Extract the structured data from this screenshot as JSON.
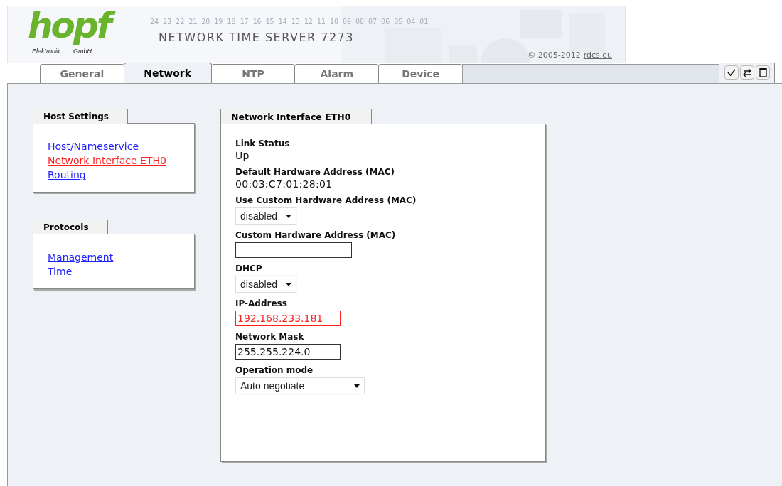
{
  "header": {
    "logo": "hopf",
    "logo_left": "Elektronik",
    "logo_right": "GmbH",
    "title": "NETWORK TIME SERVER 7273",
    "scale": "24 23 22 21 20 19 18 17 16 15 14 13 12 11 10 09 08 07 06 05 04 01",
    "copyright": "© 2005-2012",
    "copyright_link": "rdcs.eu"
  },
  "tabs": [
    {
      "label": "General",
      "selected": false
    },
    {
      "label": "Network",
      "selected": true
    },
    {
      "label": "NTP",
      "selected": false
    },
    {
      "label": "Alarm",
      "selected": false
    },
    {
      "label": "Device",
      "selected": false
    }
  ],
  "toolbar": [
    {
      "kind": "check"
    },
    {
      "kind": "swap"
    },
    {
      "kind": "page"
    }
  ],
  "panels": [
    {
      "title": "Host Settings",
      "links": [
        {
          "label": "Host/Nameservice",
          "selected": false
        },
        {
          "label": "Network Interface ETH0",
          "selected": true
        },
        {
          "label": "Routing",
          "selected": false
        }
      ]
    },
    {
      "title": "Protocols",
      "links": [
        {
          "label": "Management",
          "selected": false
        },
        {
          "label": "Time",
          "selected": false
        }
      ]
    }
  ],
  "interface": {
    "title": "Network Interface ETH0",
    "fields": [
      {
        "kind": "info",
        "label": "Link Status",
        "value": "Up"
      },
      {
        "kind": "info",
        "label": "Default Hardware Address (MAC)",
        "value": "00:03:C7:01:28:01"
      },
      {
        "kind": "select",
        "label": "Use Custom Hardware Address (MAC)",
        "value": "disabled"
      },
      {
        "kind": "input",
        "label": "Custom Hardware Address (MAC)",
        "error": false
      },
      {
        "kind": "select",
        "label": "DHCP",
        "value": "disabled"
      },
      {
        "kind": "input",
        "label": "IP-Address",
        "value": "192.168.233.181",
        "error": true
      },
      {
        "kind": "input",
        "label": "Network Mask",
        "value": "255.255.224.0",
        "error": false
      },
      {
        "kind": "select",
        "label": "Operation mode",
        "value": "Auto negotiate",
        "wide": true
      }
    ]
  }
}
